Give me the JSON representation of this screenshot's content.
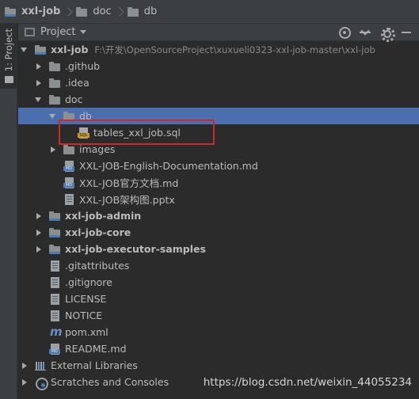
{
  "breadcrumb": {
    "items": [
      "xxl-job",
      "doc",
      "db"
    ]
  },
  "side_strip": {
    "tab_label": "1: Project"
  },
  "panel": {
    "title": "Project",
    "tools": [
      "locate-icon",
      "collapse-all-icon",
      "gear-icon",
      "hide-icon"
    ]
  },
  "tree": {
    "root_label": "xxl-job",
    "root_path": "F:\\开发\\OpenSourceProject\\xuxueli0323-xxl-job-master\\xxl-job",
    "github": ".github",
    "idea": ".idea",
    "doc": "doc",
    "db": "db",
    "sql_file": "tables_xxl_job.sql",
    "images": "images",
    "doc_en": "XXL-JOB-English-Documentation.md",
    "doc_cn": "XXL-JOB官方文档.md",
    "doc_ppt": "XXL-JOB架构图.pptx",
    "admin": "xxl-job-admin",
    "core": "xxl-job-core",
    "samples": "xxl-job-executor-samples",
    "gitattributes": ".gitattributes",
    "gitignore": ".gitignore",
    "license": "LICENSE",
    "notice": "NOTICE",
    "pom": "pom.xml",
    "readme": "README.md",
    "ext_libs": "External Libraries",
    "scratches": "Scratches and Consoles"
  },
  "watermark": "https://blog.csdn.net/weixin_44055234",
  "colors": {
    "selection": "#4b6eaf",
    "highlight_box": "#cc2a2a",
    "background": "#2b2b2b"
  }
}
